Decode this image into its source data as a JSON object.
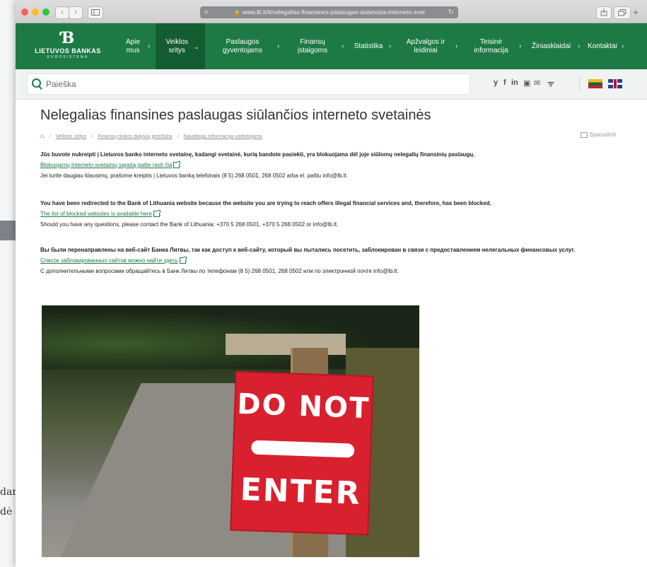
{
  "browser": {
    "url": "www.lb.lt/lt/nelegalias-finansines-paslaugas-siulancios-interneto-svet",
    "back_glyph": "‹",
    "forward_glyph": "›",
    "plus_glyph": "+"
  },
  "nav": {
    "logo_name": "LIETUVOS BANKAS",
    "logo_sub": "EUROSISTEMA",
    "items": [
      {
        "label": "Apie mus"
      },
      {
        "label": "Veiklos sritys"
      },
      {
        "label": "Paslaugos gyventojams"
      },
      {
        "label": "Finansų įstaigoms"
      },
      {
        "label": "Statistika"
      },
      {
        "label": "Apžvalgos ir leidiniai"
      },
      {
        "label": "Teisinė informacija"
      },
      {
        "label": "Žiniasklaidai"
      },
      {
        "label": "Kontaktai"
      }
    ],
    "chevron": "›",
    "accent": "#1e7a45"
  },
  "search": {
    "placeholder": "Paieška"
  },
  "social": {
    "twitter": "y",
    "facebook": "f",
    "linkedin": "in",
    "youtube": "▣",
    "email": "✉",
    "rss": "ᯤ"
  },
  "page": {
    "title": "Nelegalias finansines paslaugas siūlančios interneto svetainės",
    "breadcrumbs": [
      "Veiklos sritys",
      "Finansų rinkos dalyvių priežiūra",
      "Naudinga informacija vartotojams"
    ],
    "print_label": "Spausdinti",
    "lt": {
      "bold": "Jūs buvote nukreipti į Lietuvos banko interneto svetainę, kadangi svetainė, kurią bandote pasiekti, yra blokuojama dėl joje siūlomų nelegalių finansinių paslaugų.",
      "link": "Blokuojamų interneto svetainių sąrašą galite rasti čia",
      "contact": "Jei turite daugiau klausimų, prašome kreiptis į Lietuvos banką telefonais  (8 5) 268 0501, 268 0502 arba el. paštu info@lb.lt."
    },
    "en": {
      "bold": "You have been redirected to the Bank of Lithuania website because the website you are trying to reach offers illegal financial services and, therefore, has been blocked.",
      "link": "The list of blocked websites is available here",
      "contact": "Should you have any questions, please contact the Bank of Lithuania: +370 5 268 0501, +370 5 268 0502 or info@lb.lt."
    },
    "ru": {
      "bold": "Вы были перенаправлены на веб-сайт Банка Литвы, так как доступ к веб-сайту, который вы пытались посетить, заблокирован в связи с предоставлением нелегальных финансовых услуг.",
      "link": "Список заблокированных сайтов можно найти здесь",
      "contact": "С дополнительными вопросами обращайтесь в Банк Литвы по телефонам (8 5) 268 0501, 268 0502 или по электронной почте info@lb.lt."
    },
    "sign_top": "DO NOT",
    "sign_bottom": "ENTER"
  },
  "background": {
    "line1": "dar",
    "line2": "dė"
  }
}
